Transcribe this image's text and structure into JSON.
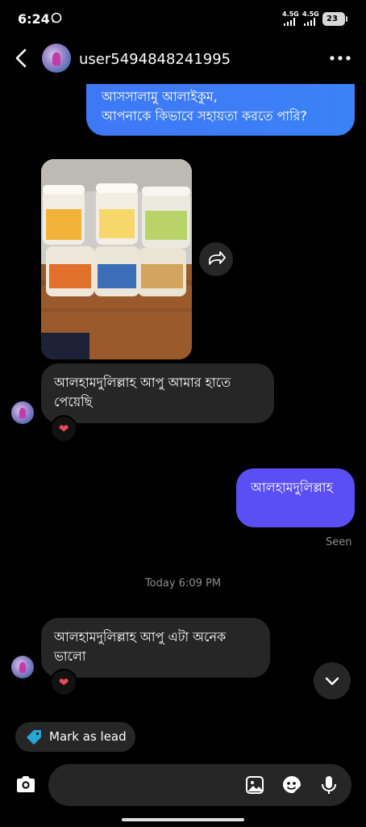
{
  "status_bar": {
    "time": "6:24",
    "network_1": "4.5G",
    "network_2": "4.5G",
    "battery": "23"
  },
  "header": {
    "username": "user5494848241995"
  },
  "messages": {
    "m1_line1": "আসসালামু আলাইকুম,",
    "m1_line2": "আপনাকে কিভাবে সহায়তা করতে পারি?",
    "m2": "আলহামদুলিল্লাহ আপু আমার হাতে পেয়েছি",
    "m2_reaction": "❤",
    "m3": "আলহামদুলিল্লাহ",
    "seen": "Seen",
    "timestamp": "Today 6:09 PM",
    "m4": "আলহামদুলিল্লাহ আপু এটা অনেক ভালো",
    "m4_reaction": "❤"
  },
  "lead_chip": {
    "label": "Mark as lead"
  },
  "composer": {
    "placeholder": ""
  },
  "colors": {
    "background": "#000000",
    "outgoing_blue": "#3b82f6",
    "outgoing_violet": "#5a4ff5",
    "incoming": "#262626",
    "reaction_heart": "#ed4956",
    "tag_icon": "#29a8d8"
  },
  "icons": [
    "back-arrow-icon",
    "more-options-icon",
    "share-icon",
    "heart-icon",
    "chevron-down-icon",
    "tag-icon",
    "camera-icon",
    "gallery-icon",
    "sticker-icon",
    "microphone-icon"
  ]
}
